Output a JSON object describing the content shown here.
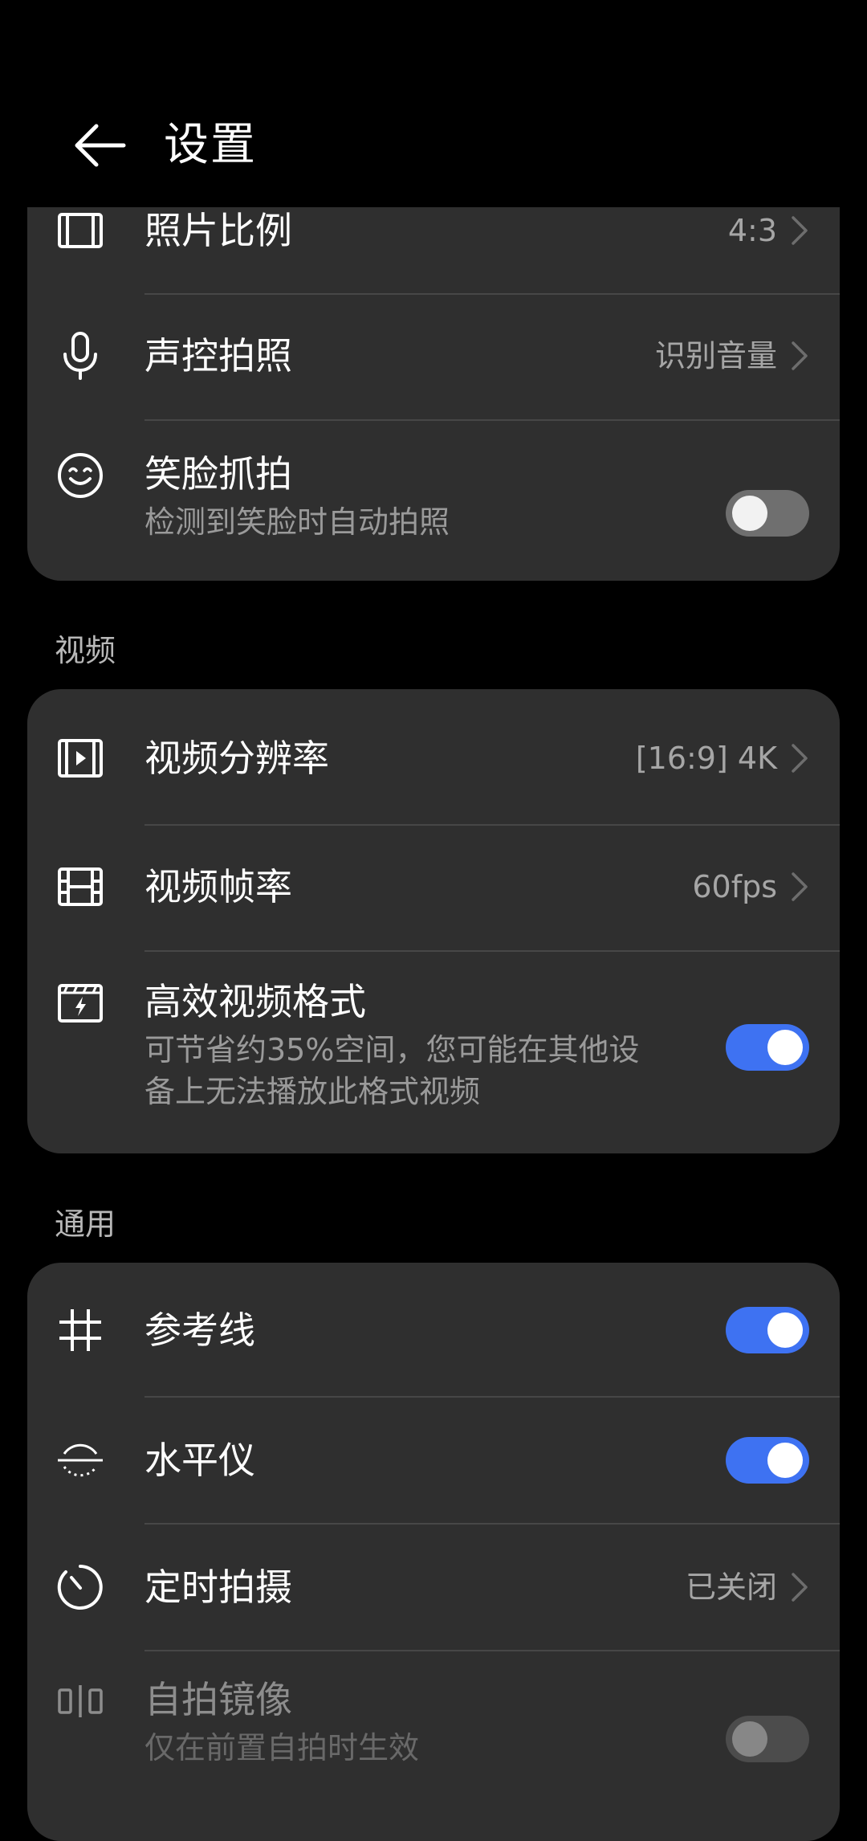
{
  "header": {
    "title": "设置",
    "back_icon": "arrow-left-icon"
  },
  "card_photo": {
    "items": [
      {
        "label": "照片比例",
        "value": "4:3",
        "icon": "aspect-ratio-icon"
      },
      {
        "label": "声控拍照",
        "value": "识别音量",
        "icon": "microphone-icon"
      },
      {
        "label": "笑脸抓拍",
        "sub": "检测到笑脸时自动拍照",
        "icon": "smile-icon",
        "toggle": false
      }
    ]
  },
  "section_video": {
    "label": "视频"
  },
  "card_video": {
    "items": [
      {
        "label": "视频分辨率",
        "value": "[16:9] 4K",
        "icon": "video-resolution-icon"
      },
      {
        "label": "视频帧率",
        "value": "60fps",
        "icon": "film-icon"
      },
      {
        "label": "高效视频格式",
        "sub": "可节省约35%空间，您可能在其他设备上无法播放此格式视频",
        "icon": "video-format-icon",
        "toggle": true
      }
    ]
  },
  "section_general": {
    "label": "通用"
  },
  "card_general": {
    "items": [
      {
        "label": "参考线",
        "icon": "grid-icon",
        "toggle": true
      },
      {
        "label": "水平仪",
        "icon": "level-icon",
        "toggle": true
      },
      {
        "label": "定时拍摄",
        "value": "已关闭",
        "icon": "timer-icon"
      },
      {
        "label": "自拍镜像",
        "sub": "仅在前置自拍时生效",
        "icon": "mirror-icon",
        "toggle": false,
        "disabled": true
      }
    ]
  },
  "colors": {
    "accent": "#3e72f2",
    "card": "#2f2f2f",
    "background": "#000000"
  }
}
